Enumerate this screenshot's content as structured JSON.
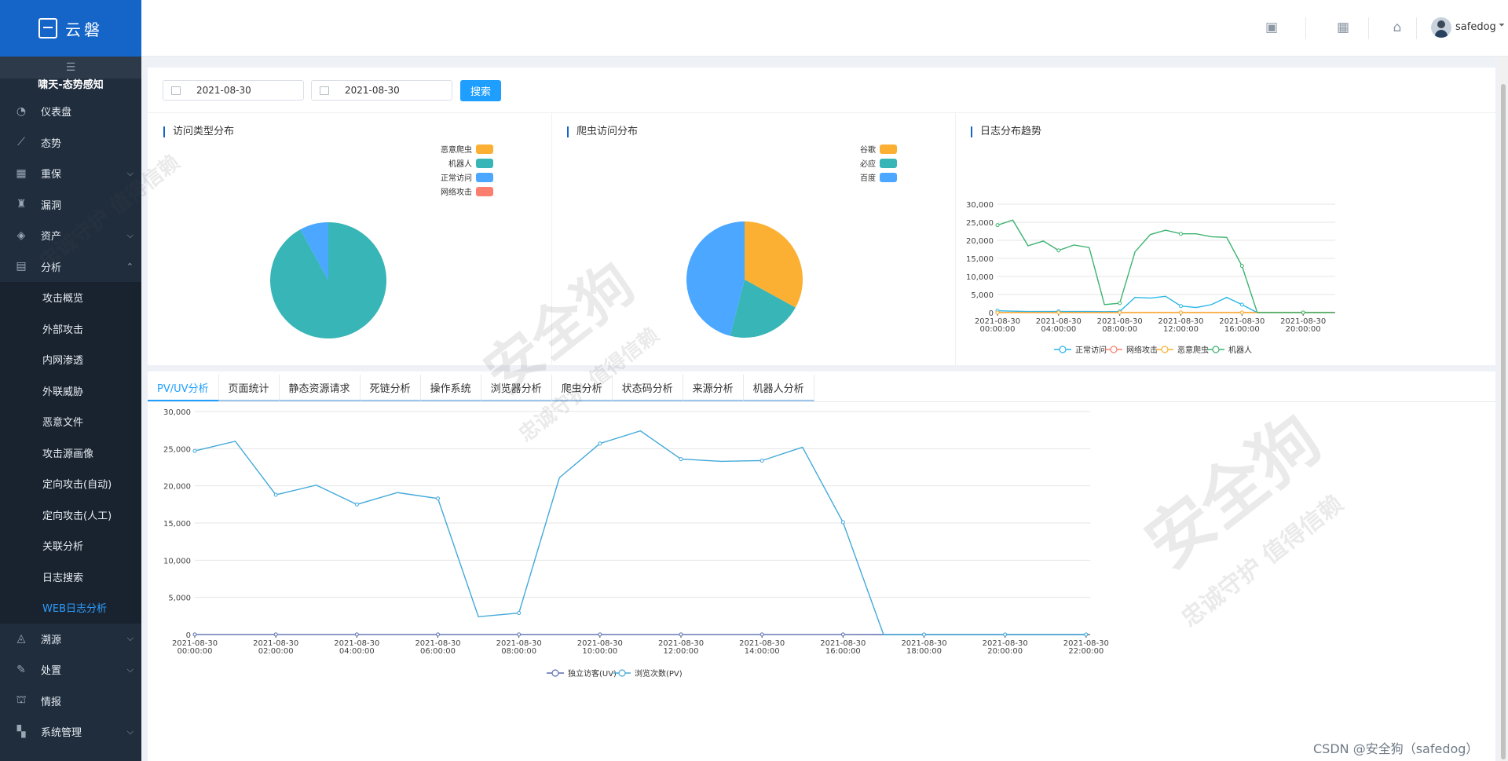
{
  "brand": {
    "name": "云磐"
  },
  "sidebar": {
    "system_title": "啸天-态势感知",
    "collapse_icon": "hamburger-icon",
    "items": [
      {
        "label": "仪表盘",
        "icon": "dashboard-icon",
        "caret": ""
      },
      {
        "label": "态势",
        "icon": "trend-icon",
        "caret": ""
      },
      {
        "label": "重保",
        "icon": "calendar-icon",
        "caret": "⌵"
      },
      {
        "label": "漏洞",
        "icon": "bug-icon",
        "caret": ""
      },
      {
        "label": "资产",
        "icon": "layers-icon",
        "caret": "⌵"
      },
      {
        "label": "分析",
        "icon": "analysis-icon",
        "caret": "⌃"
      }
    ],
    "sub_items": [
      {
        "label": "攻击概览",
        "active": false
      },
      {
        "label": "外部攻击",
        "active": false
      },
      {
        "label": "内网渗透",
        "active": false
      },
      {
        "label": "外联威胁",
        "active": false
      },
      {
        "label": "恶意文件",
        "active": false
      },
      {
        "label": "攻击源画像",
        "active": false
      },
      {
        "label": "定向攻击(自动)",
        "active": false
      },
      {
        "label": "定向攻击(人工)",
        "active": false
      },
      {
        "label": "关联分析",
        "active": false
      },
      {
        "label": "日志搜索",
        "active": false
      },
      {
        "label": "WEB日志分析",
        "active": true
      }
    ],
    "items_after": [
      {
        "label": "溯源",
        "icon": "trace-icon",
        "caret": "⌵"
      },
      {
        "label": "处置",
        "icon": "handle-icon",
        "caret": "⌵"
      },
      {
        "label": "情报",
        "icon": "intel-icon",
        "caret": ""
      },
      {
        "label": "系统管理",
        "icon": "grid-icon",
        "caret": "⌵"
      }
    ]
  },
  "header": {
    "icons": [
      "task-icon",
      "calendar-icon",
      "alert-icon"
    ],
    "user_name": "safedog",
    "caret": "⏷"
  },
  "filters": {
    "start_date": "2021-08-30",
    "end_date": "2021-08-30",
    "search_label": "搜索"
  },
  "panels": {
    "visit_type": {
      "title": "访问类型分布"
    },
    "crawler": {
      "title": "爬虫访问分布"
    },
    "log_trend": {
      "title": "日志分布趋势"
    }
  },
  "tabs": [
    {
      "label": "PV/UV分析",
      "active": true
    },
    {
      "label": "页面统计",
      "active": false
    },
    {
      "label": "静态资源请求",
      "active": false
    },
    {
      "label": "死链分析",
      "active": false
    },
    {
      "label": "操作系统",
      "active": false
    },
    {
      "label": "浏览器分析",
      "active": false
    },
    {
      "label": "爬虫分析",
      "active": false
    },
    {
      "label": "状态码分析",
      "active": false
    },
    {
      "label": "来源分析",
      "active": false
    },
    {
      "label": "机器人分析",
      "active": false
    }
  ],
  "footer": {
    "credit": "CSDN @安全狗（safedog）"
  },
  "watermark": {
    "brand": "安全狗",
    "slogan": "忠诚守护 值得信赖"
  },
  "colors": {
    "brand_blue": "#1565c8",
    "accent": "#1e9fff",
    "orange": "#fbb034",
    "teal": "#37b5b7",
    "light_blue": "#4ba7ff",
    "salmon": "#fb7f6e",
    "green": "#3cb371",
    "pv_line": "#43a9d9",
    "uv_line": "#5a6fb0"
  },
  "chart_data": [
    {
      "type": "pie",
      "title": "访问类型分布",
      "legend_position": "top-right",
      "slices": [
        {
          "name": "恶意爬虫",
          "value": 0,
          "color": "#fbb034"
        },
        {
          "name": "机器人",
          "value": 92,
          "color": "#37b5b7"
        },
        {
          "name": "正常访问",
          "value": 8,
          "color": "#4ba7ff"
        },
        {
          "name": "网络攻击",
          "value": 0,
          "color": "#fb7f6e"
        }
      ]
    },
    {
      "type": "pie",
      "title": "爬虫访问分布",
      "legend_position": "top-right",
      "slices": [
        {
          "name": "谷歌",
          "value": 33,
          "color": "#fbb034"
        },
        {
          "name": "必应",
          "value": 21,
          "color": "#37b5b7"
        },
        {
          "name": "百度",
          "value": 46,
          "color": "#4ba7ff"
        }
      ]
    },
    {
      "type": "line",
      "title": "日志分布趋势",
      "legend_position": "bottom",
      "ylim": [
        0,
        30000
      ],
      "yticks": [
        "30,000",
        "25,000",
        "20,000",
        "15,000",
        "10,000",
        "5,000",
        "0"
      ],
      "xtick_labels": [
        [
          "2021-08-30",
          "00:00:00"
        ],
        [
          "2021-08-30",
          "04:00:00"
        ],
        [
          "2021-08-30",
          "08:00:00"
        ],
        [
          "2021-08-30",
          "12:00:00"
        ],
        [
          "2021-08-30",
          "16:00:00"
        ],
        [
          "2021-08-30",
          "20:00:00"
        ]
      ],
      "x_hours": [
        0,
        1,
        2,
        3,
        4,
        5,
        6,
        7,
        8,
        9,
        10,
        11,
        12,
        13,
        14,
        15,
        16,
        17,
        18,
        19,
        20,
        21,
        22
      ],
      "series": [
        {
          "name": "正常访问",
          "color": "#29b6e8",
          "values": [
            500,
            400,
            300,
            300,
            300,
            300,
            300,
            250,
            300,
            4200,
            4000,
            4500,
            1800,
            1400,
            2200,
            4200,
            2200,
            0,
            0,
            0,
            0,
            0,
            0
          ]
        },
        {
          "name": "网络攻击",
          "color": "#fb7f6e",
          "values": [
            0,
            0,
            0,
            0,
            0,
            0,
            0,
            0,
            0,
            0,
            0,
            0,
            0,
            0,
            0,
            0,
            0,
            0,
            0,
            0,
            0,
            0,
            0
          ]
        },
        {
          "name": "恶意爬虫",
          "color": "#fbb034",
          "values": [
            0,
            0,
            0,
            0,
            0,
            0,
            0,
            0,
            0,
            0,
            0,
            0,
            0,
            0,
            0,
            0,
            0,
            0,
            0,
            0,
            0,
            0,
            0
          ]
        },
        {
          "name": "机器人",
          "color": "#3cb371",
          "values": [
            24200,
            25600,
            18500,
            19800,
            17200,
            18700,
            18000,
            2200,
            2600,
            16800,
            21600,
            22800,
            21800,
            21800,
            21000,
            20800,
            12900,
            0,
            0,
            0,
            0,
            0,
            0
          ]
        }
      ]
    },
    {
      "type": "line",
      "title": "PV/UV分析",
      "legend_position": "bottom",
      "ylim": [
        0,
        30000
      ],
      "yticks": [
        "30,000",
        "25,000",
        "20,000",
        "15,000",
        "10,000",
        "5,000",
        "0"
      ],
      "xtick_labels": [
        [
          "2021-08-30",
          "00:00:00"
        ],
        [
          "2021-08-30",
          "02:00:00"
        ],
        [
          "2021-08-30",
          "04:00:00"
        ],
        [
          "2021-08-30",
          "06:00:00"
        ],
        [
          "2021-08-30",
          "08:00:00"
        ],
        [
          "2021-08-30",
          "10:00:00"
        ],
        [
          "2021-08-30",
          "12:00:00"
        ],
        [
          "2021-08-30",
          "14:00:00"
        ],
        [
          "2021-08-30",
          "16:00:00"
        ],
        [
          "2021-08-30",
          "18:00:00"
        ],
        [
          "2021-08-30",
          "20:00:00"
        ],
        [
          "2021-08-30",
          "22:00:00"
        ]
      ],
      "x_hours": [
        0,
        1,
        2,
        3,
        4,
        5,
        6,
        7,
        8,
        9,
        10,
        11,
        12,
        13,
        14,
        15,
        16,
        17,
        18,
        19,
        20,
        21,
        22
      ],
      "series": [
        {
          "name": "独立访客(UV)",
          "color": "#5a6fb0",
          "values": [
            10,
            10,
            10,
            10,
            10,
            10,
            10,
            10,
            10,
            10,
            10,
            10,
            10,
            10,
            10,
            10,
            10,
            0,
            0,
            0,
            0,
            0,
            0
          ]
        },
        {
          "name": "浏览次数(PV)",
          "color": "#43a9d9",
          "values": [
            24700,
            26000,
            18800,
            20100,
            17500,
            19100,
            18300,
            2400,
            2900,
            21100,
            25700,
            27400,
            23600,
            23300,
            23400,
            25200,
            15100,
            0,
            0,
            0,
            0,
            0,
            0
          ]
        }
      ]
    }
  ]
}
